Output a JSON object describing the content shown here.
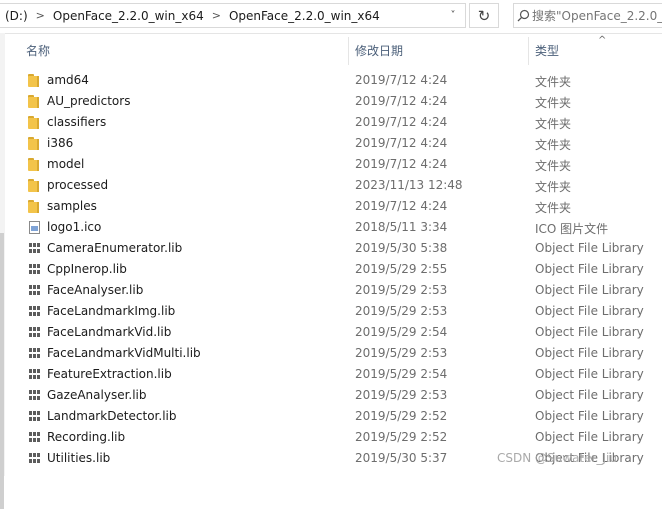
{
  "address": {
    "crumbs": [
      "(D:)",
      "OpenFace_2.2.0_win_x64",
      "OpenFace_2.2.0_win_x64"
    ],
    "separator": ">",
    "dropdown": "˅",
    "refresh": "↻"
  },
  "search": {
    "placeholder": "搜索\"OpenFace_2.2.0_win_x64\""
  },
  "columns": {
    "name": "名称",
    "date": "修改日期",
    "type": "类型"
  },
  "sort_indicator": "^",
  "files": [
    {
      "name": "amd64",
      "date": "2019/7/12 4:24",
      "type": "文件夹",
      "icon": "folder"
    },
    {
      "name": "AU_predictors",
      "date": "2019/7/12 4:24",
      "type": "文件夹",
      "icon": "folder"
    },
    {
      "name": "classifiers",
      "date": "2019/7/12 4:24",
      "type": "文件夹",
      "icon": "folder"
    },
    {
      "name": "i386",
      "date": "2019/7/12 4:24",
      "type": "文件夹",
      "icon": "folder"
    },
    {
      "name": "model",
      "date": "2019/7/12 4:24",
      "type": "文件夹",
      "icon": "folder"
    },
    {
      "name": "processed",
      "date": "2023/11/13 12:48",
      "type": "文件夹",
      "icon": "folder"
    },
    {
      "name": "samples",
      "date": "2019/7/12 4:24",
      "type": "文件夹",
      "icon": "folder"
    },
    {
      "name": "logo1.ico",
      "date": "2018/5/11 3:34",
      "type": "ICO 图片文件",
      "icon": "ico"
    },
    {
      "name": "CameraEnumerator.lib",
      "date": "2019/5/30 5:38",
      "type": "Object File Library",
      "icon": "lib"
    },
    {
      "name": "CppInerop.lib",
      "date": "2019/5/29 2:55",
      "type": "Object File Library",
      "icon": "lib"
    },
    {
      "name": "FaceAnalyser.lib",
      "date": "2019/5/29 2:53",
      "type": "Object File Library",
      "icon": "lib"
    },
    {
      "name": "FaceLandmarkImg.lib",
      "date": "2019/5/29 2:53",
      "type": "Object File Library",
      "icon": "lib"
    },
    {
      "name": "FaceLandmarkVid.lib",
      "date": "2019/5/29 2:54",
      "type": "Object File Library",
      "icon": "lib"
    },
    {
      "name": "FaceLandmarkVidMulti.lib",
      "date": "2019/5/29 2:53",
      "type": "Object File Library",
      "icon": "lib"
    },
    {
      "name": "FeatureExtraction.lib",
      "date": "2019/5/29 2:54",
      "type": "Object File Library",
      "icon": "lib"
    },
    {
      "name": "GazeAnalyser.lib",
      "date": "2019/5/29 2:53",
      "type": "Object File Library",
      "icon": "lib"
    },
    {
      "name": "LandmarkDetector.lib",
      "date": "2019/5/29 2:52",
      "type": "Object File Library",
      "icon": "lib"
    },
    {
      "name": "Recording.lib",
      "date": "2019/5/29 2:52",
      "type": "Object File Library",
      "icon": "lib"
    },
    {
      "name": "Utilities.lib",
      "date": "2019/5/30 5:37",
      "type": "Object File Library",
      "icon": "lib"
    }
  ],
  "watermark": "CSDN @Suwater_Jiu",
  "colors": {
    "folder": "#f3c44a",
    "header_text": "#4c607a",
    "detail_text": "#6d6d6d"
  }
}
